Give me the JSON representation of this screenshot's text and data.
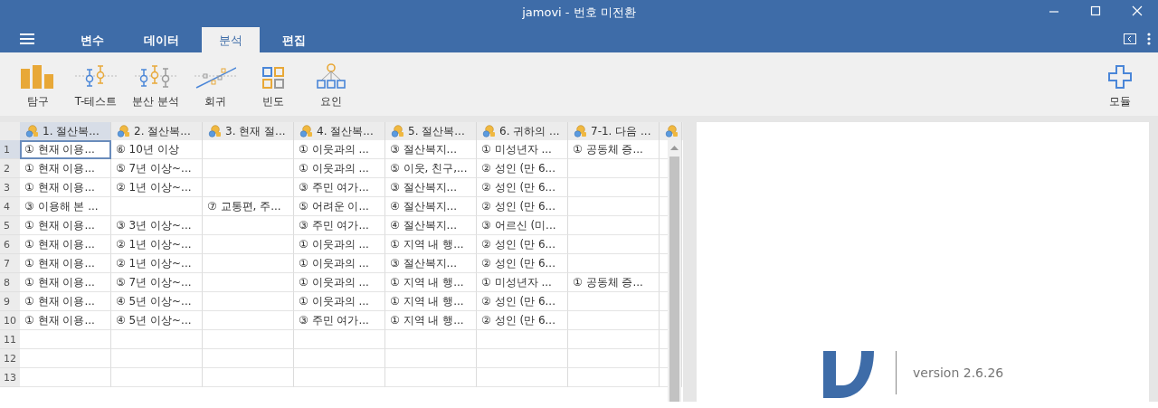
{
  "window": {
    "title": "jamovi - 번호 미전환"
  },
  "tabs": [
    {
      "label": "변수",
      "selected": false
    },
    {
      "label": "데이터",
      "selected": false
    },
    {
      "label": "분석",
      "selected": true
    },
    {
      "label": "편집",
      "selected": false
    }
  ],
  "ribbon": {
    "items": [
      {
        "label": "탐구"
      },
      {
        "label": "T-테스트"
      },
      {
        "label": "분산 분석"
      },
      {
        "label": "회귀"
      },
      {
        "label": "빈도"
      },
      {
        "label": "요인"
      }
    ],
    "modules": {
      "label": "모듈"
    }
  },
  "table": {
    "columns": [
      {
        "label": "1. 절산복...",
        "selected": true
      },
      {
        "label": "2. 절산복...",
        "selected": false
      },
      {
        "label": "3. 현재 절...",
        "selected": false
      },
      {
        "label": "4. 절산복...",
        "selected": false
      },
      {
        "label": "5. 절산복...",
        "selected": false
      },
      {
        "label": "6. 귀하의 ...",
        "selected": false
      },
      {
        "label": "7-1. 다음 ...",
        "selected": false
      },
      {
        "selected": false
      }
    ],
    "rows": [
      {
        "number": "1",
        "selected": true,
        "cells": [
          "① 현재 이용...",
          "⑥ 10년 이상",
          null,
          "① 이웃과의 ...",
          "③ 절산복지...",
          "① 미성년자 ...",
          "① 공동체 증...",
          null
        ]
      },
      {
        "number": "2",
        "selected": false,
        "cells": [
          "① 현재 이용...",
          "⑤ 7년 이상~...",
          null,
          "① 이웃과의 ...",
          "⑤ 이웃, 친구,...",
          "② 성인 (만 6...",
          null,
          null
        ]
      },
      {
        "number": "3",
        "selected": false,
        "cells": [
          "① 현재 이용...",
          "② 1년 이상~...",
          null,
          "③ 주민 여가...",
          "③ 절산복지...",
          "② 성인 (만 6...",
          null,
          null
        ]
      },
      {
        "number": "4",
        "selected": false,
        "cells": [
          "③ 이용해 본 ...",
          null,
          "⑦ 교통편, 주...",
          "⑤ 어려운 이...",
          "④ 절산복지...",
          "② 성인 (만 6...",
          null,
          null
        ]
      },
      {
        "number": "5",
        "selected": false,
        "cells": [
          "① 현재 이용...",
          "③ 3년 이상~...",
          null,
          "③ 주민 여가...",
          "④ 절산복지...",
          "③ 어르신 (미...",
          null,
          null
        ]
      },
      {
        "number": "6",
        "selected": false,
        "cells": [
          "① 현재 이용...",
          "② 1년 이상~...",
          null,
          "① 이웃과의 ...",
          "① 지역 내 행...",
          "② 성인 (만 6...",
          null,
          null
        ]
      },
      {
        "number": "7",
        "selected": false,
        "cells": [
          "① 현재 이용...",
          "② 1년 이상~...",
          null,
          "① 이웃과의 ...",
          "③ 절산복지...",
          "② 성인 (만 6...",
          null,
          null
        ]
      },
      {
        "number": "8",
        "selected": false,
        "cells": [
          "① 현재 이용...",
          "⑤ 7년 이상~...",
          null,
          "① 이웃과의 ...",
          "① 지역 내 행...",
          "① 미성년자 ...",
          "① 공동체 증...",
          null
        ]
      },
      {
        "number": "9",
        "selected": false,
        "cells": [
          "① 현재 이용...",
          "④ 5년 이상~...",
          null,
          "① 이웃과의 ...",
          "① 지역 내 행...",
          "② 성인 (만 6...",
          null,
          null
        ]
      },
      {
        "number": "10",
        "selected": false,
        "cells": [
          "① 현재 이용...",
          "④ 5년 이상~...",
          null,
          "③ 주민 여가...",
          "① 지역 내 행...",
          "② 성인 (만 6...",
          null,
          null
        ]
      },
      {
        "number": "11",
        "selected": false,
        "cells": []
      },
      {
        "number": "12",
        "selected": false,
        "cells": []
      },
      {
        "number": "13",
        "selected": false,
        "cells": []
      }
    ]
  },
  "results": {
    "version": "version 2.6.26"
  }
}
